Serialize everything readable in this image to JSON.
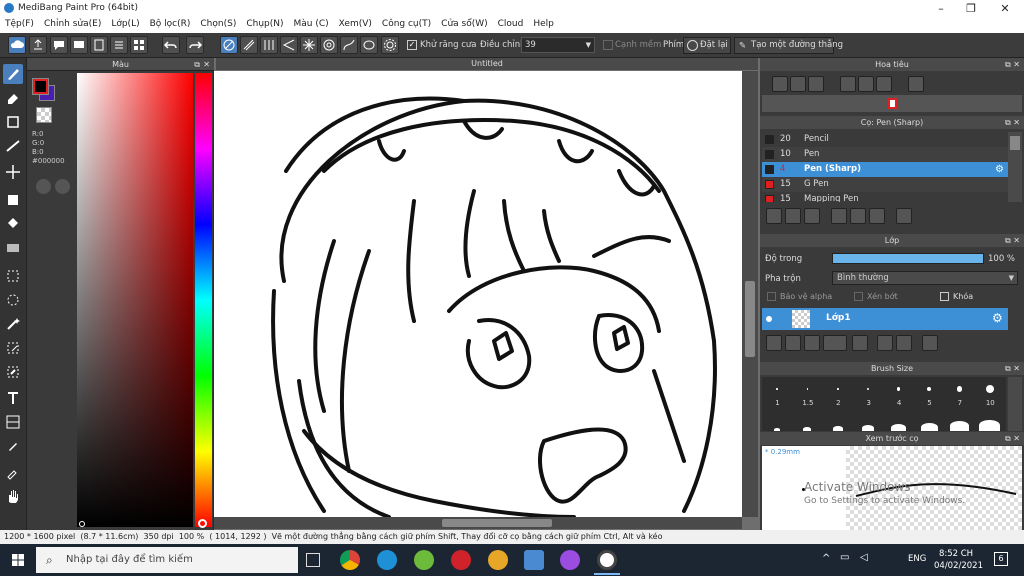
{
  "window": {
    "title": "MediBang Paint Pro (64bit)"
  },
  "menu": [
    "Tệp(F)",
    "Chỉnh sửa(E)",
    "Lớp(L)",
    "Bộ lọc(R)",
    "Chọn(S)",
    "Chụp(N)",
    "Màu (C)",
    "Xem(V)",
    "Công cụ(T)",
    "Cửa sổ(W)",
    "Cloud",
    "Help"
  ],
  "toolbar": {
    "antialias_label": "Khử răng cưa",
    "correction_label": "Điều chỉnh",
    "correction_value": "39",
    "canh_mem_label": "Cạnh mềm",
    "phim_label": "Phím",
    "reset_label": "Đặt lại",
    "line_label": "Tạo một đường thẳng"
  },
  "color_panel": {
    "title": "Màu",
    "r": "R:0",
    "g": "G:0",
    "b": "B:0",
    "hex": "#000000",
    "primary": "#000000",
    "secondary": "#4a1fb0"
  },
  "canvas": {
    "tab": "Untitled"
  },
  "navigator": {
    "title": "Hoa tiêu"
  },
  "brush": {
    "title": "Cọ: Pen (Sharp)",
    "items": [
      {
        "size": "20",
        "name": "Pencil",
        "color": "#222222",
        "selected": false
      },
      {
        "size": "10",
        "name": "Pen",
        "color": "#222222",
        "selected": false
      },
      {
        "size": "4",
        "name": "Pen (Sharp)",
        "color": "#222222",
        "selected": true
      },
      {
        "size": "15",
        "name": "G Pen",
        "color": "#e02020",
        "selected": false
      },
      {
        "size": "15",
        "name": "Mapping Pen",
        "color": "#e02020",
        "selected": false
      }
    ]
  },
  "layer": {
    "title": "Lớp",
    "opacity_label": "Độ trong",
    "opacity_value": "100 %",
    "blend_label": "Pha trộn",
    "blend_value": "Bình thường",
    "protect_alpha": "Bảo vệ alpha",
    "clipping": "Xén bớt",
    "lock": "Khóa",
    "layer_name": "Lớp1"
  },
  "brush_size": {
    "title": "Brush Size",
    "labels": [
      "1",
      "1.5",
      "2",
      "3",
      "4",
      "5",
      "7",
      "10"
    ]
  },
  "preview": {
    "title": "Xem trước cọ",
    "size": "* 0.29mm",
    "watermark1": "Activate Windows",
    "watermark2": "Go to Settings to activate Windows."
  },
  "status": {
    "size": "1200 * 1600 pixel",
    "cm": "(8.7 * 11.6cm)",
    "dpi": "350 dpi",
    "zoom": "100 %",
    "coords": "( 1014, 1292 )",
    "hint": "Vẽ một đường thẳng bằng cách giữ phím Shift, Thay đổi cỡ cọ bằng cách giữ phím Ctrl, Alt và kéo"
  },
  "taskbar": {
    "search_placeholder": "Nhập tại đây để tìm kiếm",
    "lang": "ENG",
    "time": "8:52 CH",
    "date": "04/02/2021",
    "notif_count": "6"
  }
}
